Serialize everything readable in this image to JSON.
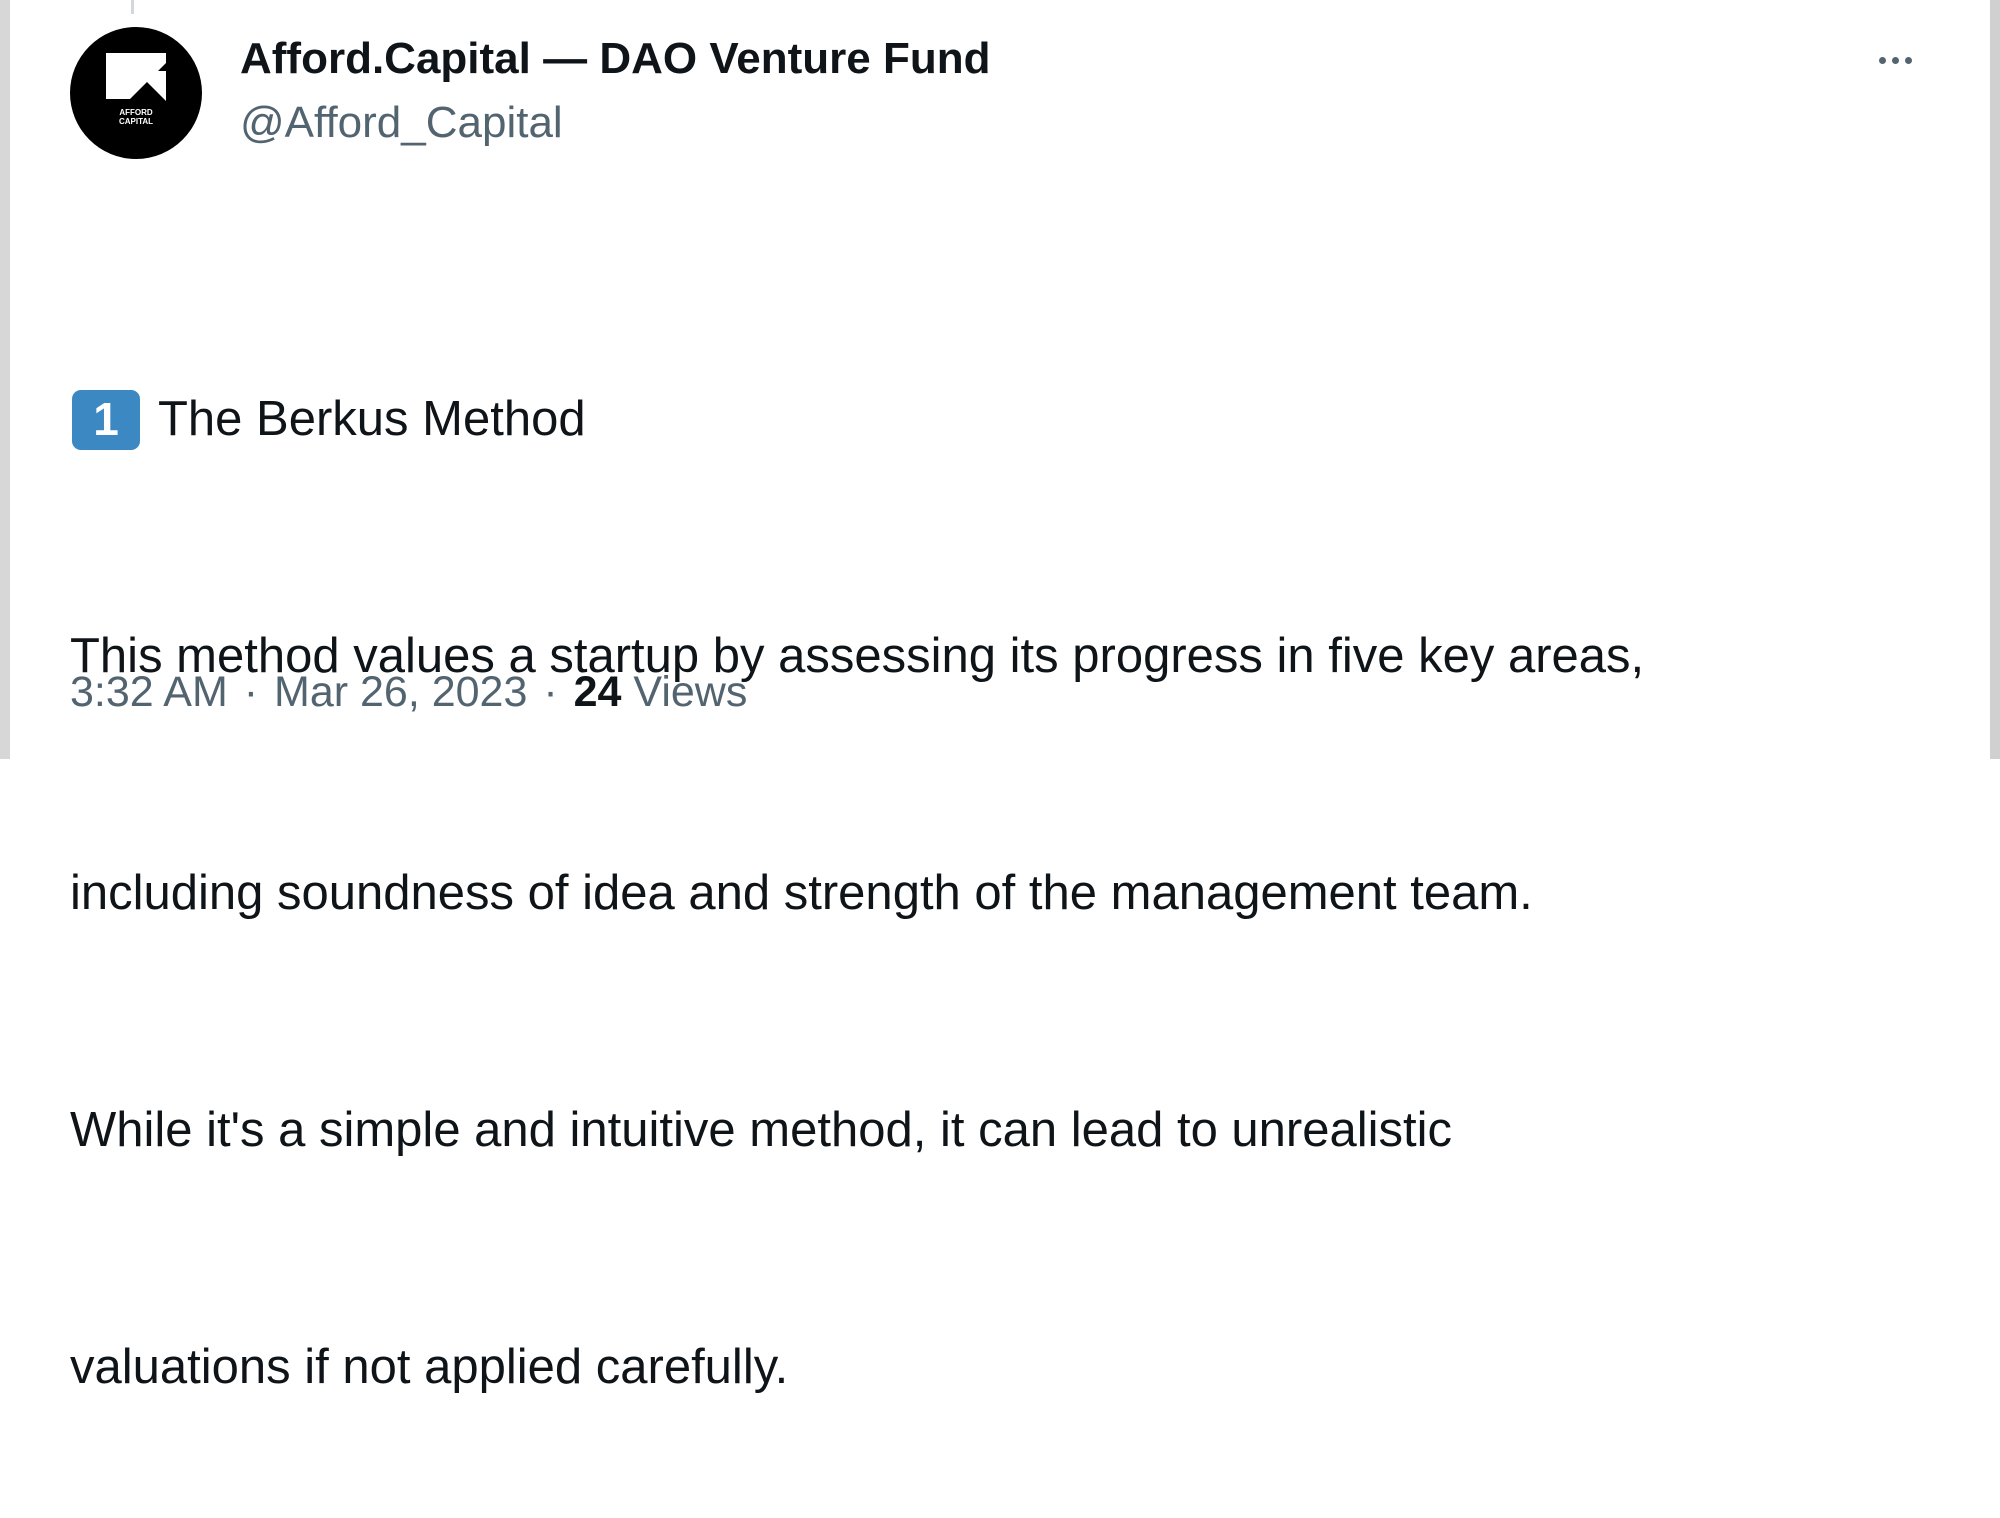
{
  "tweet": {
    "author_name": "Afford.Capital — DAO Venture Fund",
    "author_handle": "@Afford_Capital",
    "avatar_text": [
      "AFFORD",
      "CAPITAL"
    ],
    "heading_number": "1",
    "heading_text": "The Berkus Method",
    "body_lines": [
      "This method values a startup by assessing its progress in five key areas,",
      "including soundness of idea and strength of the management team.",
      "While it's a simple and intuitive method, it can lead to unrealistic",
      "valuations if not applied carefully."
    ],
    "time": "3:32 AM",
    "date": "Mar 26, 2023",
    "separator": "·",
    "views_count": "24",
    "views_label": "Views"
  },
  "icons": {
    "more": "more-options-icon",
    "avatar": "afford-capital-logo-icon",
    "keycap": "keycap-digit-one-icon"
  },
  "colors": {
    "text_primary": "#0f1419",
    "text_secondary": "#536471",
    "keycap_blue": "#3b88c3",
    "avatar_bg": "#000000"
  }
}
